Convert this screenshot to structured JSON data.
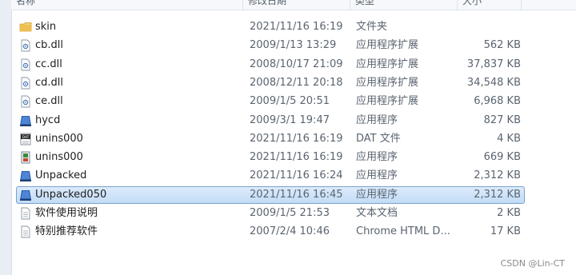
{
  "columns": {
    "name": "名称",
    "date": "修改日期",
    "type": "类型",
    "size": "大小"
  },
  "files": [
    {
      "name": "skin",
      "date": "2021/11/16 16:19",
      "type": "文件夹",
      "size": "",
      "icon": "folder-icon"
    },
    {
      "name": "cb.dll",
      "date": "2009/1/13 13:29",
      "type": "应用程序扩展",
      "size": "562 KB",
      "icon": "dll-icon"
    },
    {
      "name": "cc.dll",
      "date": "2008/10/17 21:09",
      "type": "应用程序扩展",
      "size": "37,837 KB",
      "icon": "dll-icon"
    },
    {
      "name": "cd.dll",
      "date": "2008/12/11 20:18",
      "type": "应用程序扩展",
      "size": "34,548 KB",
      "icon": "dll-icon"
    },
    {
      "name": "ce.dll",
      "date": "2009/1/5 20:51",
      "type": "应用程序扩展",
      "size": "6,968 KB",
      "icon": "dll-icon"
    },
    {
      "name": "hycd",
      "date": "2009/3/1 19:47",
      "type": "应用程序",
      "size": "827 KB",
      "icon": "app-icon"
    },
    {
      "name": "unins000",
      "date": "2021/11/16 16:19",
      "type": "DAT 文件",
      "size": "4 KB",
      "icon": "dat-icon"
    },
    {
      "name": "unins000",
      "date": "2021/11/16 16:19",
      "type": "应用程序",
      "size": "669 KB",
      "icon": "installer-icon"
    },
    {
      "name": "Unpacked",
      "date": "2021/11/16 16:24",
      "type": "应用程序",
      "size": "2,312 KB",
      "icon": "app-icon"
    },
    {
      "name": "Unpacked050",
      "date": "2021/11/16 16:45",
      "type": "应用程序",
      "size": "2,312 KB",
      "icon": "app-icon",
      "selected": true
    },
    {
      "name": "软件使用说明",
      "date": "2009/1/5 21:53",
      "type": "文本文档",
      "size": "2 KB",
      "icon": "text-file-icon"
    },
    {
      "name": "特别推荐软件",
      "date": "2007/2/4 10:46",
      "type": "Chrome HTML D...",
      "size": "17 KB",
      "icon": "text-file-icon"
    }
  ],
  "watermark": "CSDN @Lin-CT",
  "colors": {
    "selection": "#cce2f8",
    "selection_border": "#7da2ce",
    "folder": "#e8b848",
    "app": "#2d5fa8"
  }
}
